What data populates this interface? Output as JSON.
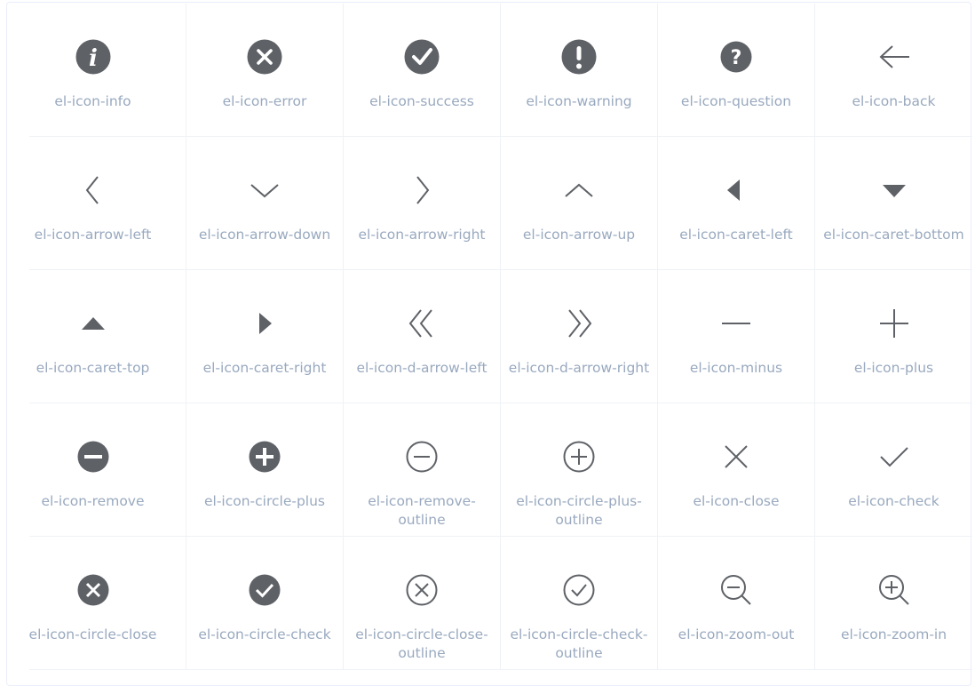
{
  "colors": {
    "icon": "#5e6166",
    "label": "#99a9bf",
    "divider": "#eff2f6"
  },
  "icons": [
    {
      "label": "el-icon-info",
      "icon": "info-icon"
    },
    {
      "label": "el-icon-error",
      "icon": "error-icon"
    },
    {
      "label": "el-icon-success",
      "icon": "success-icon"
    },
    {
      "label": "el-icon-warning",
      "icon": "warning-icon"
    },
    {
      "label": "el-icon-question",
      "icon": "question-icon"
    },
    {
      "label": "el-icon-back",
      "icon": "back-icon"
    },
    {
      "label": "el-icon-arrow-left",
      "icon": "arrow-left-icon"
    },
    {
      "label": "el-icon-arrow-down",
      "icon": "arrow-down-icon"
    },
    {
      "label": "el-icon-arrow-right",
      "icon": "arrow-right-icon"
    },
    {
      "label": "el-icon-arrow-up",
      "icon": "arrow-up-icon"
    },
    {
      "label": "el-icon-caret-left",
      "icon": "caret-left-icon"
    },
    {
      "label": "el-icon-caret-bottom",
      "icon": "caret-bottom-icon"
    },
    {
      "label": "el-icon-caret-top",
      "icon": "caret-top-icon"
    },
    {
      "label": "el-icon-caret-right",
      "icon": "caret-right-icon"
    },
    {
      "label": "el-icon-d-arrow-left",
      "icon": "d-arrow-left-icon"
    },
    {
      "label": "el-icon-d-arrow-right",
      "icon": "d-arrow-right-icon"
    },
    {
      "label": "el-icon-minus",
      "icon": "minus-icon"
    },
    {
      "label": "el-icon-plus",
      "icon": "plus-icon"
    },
    {
      "label": "el-icon-remove",
      "icon": "remove-icon"
    },
    {
      "label": "el-icon-circle-plus",
      "icon": "circle-plus-icon"
    },
    {
      "label": "el-icon-remove-outline",
      "icon": "remove-outline-icon"
    },
    {
      "label": "el-icon-circle-plus-outline",
      "icon": "circle-plus-outline-icon"
    },
    {
      "label": "el-icon-close",
      "icon": "close-icon"
    },
    {
      "label": "el-icon-check",
      "icon": "check-icon"
    },
    {
      "label": "el-icon-circle-close",
      "icon": "circle-close-icon"
    },
    {
      "label": "el-icon-circle-check",
      "icon": "circle-check-icon"
    },
    {
      "label": "el-icon-circle-close-outline",
      "icon": "circle-close-outline-icon"
    },
    {
      "label": "el-icon-circle-check-outline",
      "icon": "circle-check-outline-icon"
    },
    {
      "label": "el-icon-zoom-out",
      "icon": "zoom-out-icon"
    },
    {
      "label": "el-icon-zoom-in",
      "icon": "zoom-in-icon"
    }
  ]
}
